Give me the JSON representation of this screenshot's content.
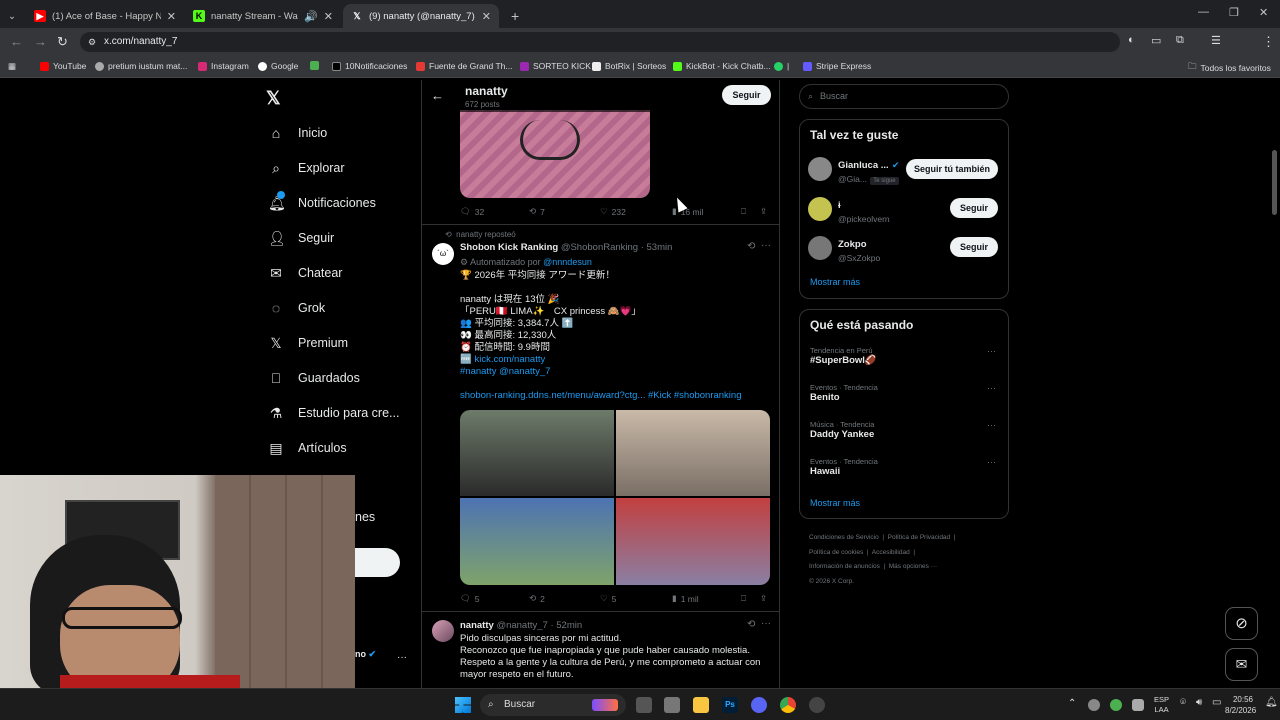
{
  "browser": {
    "tabs": [
      {
        "title": "(1) Ace of Base - Happy Nation",
        "color": "#ff0000"
      },
      {
        "title": "nanatty Stream - Watch Live",
        "color": "#53fc18"
      },
      {
        "title": "(9) nanatty (@nanatty_7) / X",
        "color": "#ffffff"
      }
    ],
    "new_tab": "+",
    "url": "x.com/nanatty_7",
    "bookmarks": [
      "YouTube",
      "pretium iustum mat...",
      "Instagram",
      "Google",
      "10Notificaciones",
      "Fuente de Grand Th...",
      "SORTEO KICK",
      "BotRix | Sorteos",
      "KickBot - Kick Chatb...",
      "Stripe Express"
    ],
    "bookmarks_all": "Todos los favoritos"
  },
  "nav": {
    "items": [
      "Inicio",
      "Explorar",
      "Notificaciones",
      "Seguir",
      "Chatear",
      "Grok",
      "Premium",
      "Guardados",
      "Estudio para cre...",
      "Artículos"
    ],
    "partial_item": "nes",
    "account_partial": "no"
  },
  "profile_header": {
    "name": "nanatty",
    "posts": "672 posts",
    "follow": "Seguir"
  },
  "post0": {
    "replies": "32",
    "reposts": "7",
    "likes": "232",
    "views": "16 mil"
  },
  "post1": {
    "reposted_by": "nanatty reposteó",
    "author": "Shobon Kick Ranking",
    "handle": "@ShobonRanking · 53min",
    "automated": "Automatizado por",
    "automated_by": "@nnndesun",
    "lines": [
      "🏆 2026年 平均同接 アワード更新！",
      "",
      "nanatty は現在 13位 🎉",
      "「PERU🇵🇪 LIMA✨　CX princess 🙈💗」",
      "👥 平均同接: 3,384.7人 ⬆️",
      "👀 最高同接: 12,330人",
      "⏰ 配信時間: 9.9時間"
    ],
    "kick_link": "kick.com/nanatty",
    "tags": "#nanatty @nanatty_7",
    "url_line": "shobon-ranking.ddns.net/menu/award?ctg... #Kick #shobonranking",
    "replies": "5",
    "reposts": "2",
    "likes": "5",
    "views": "1 mil"
  },
  "post2": {
    "author": "nanatty",
    "handle": "@nanatty_7 · 52min",
    "lines": [
      "Pido disculpas sinceras por mi actitud.",
      "Reconozco que fue inapropiada y que pude haber causado molestia.",
      "Respeto a la gente y la cultura de Perú, y me comprometo a actuar con",
      "mayor respeto en el futuro."
    ]
  },
  "right": {
    "search_placeholder": "Buscar",
    "suggest_title": "Tal vez te guste",
    "suggestions": [
      {
        "name": "Gianluca ...",
        "handle": "@Gia...",
        "badge": "Te sigue",
        "button": "Seguir tú también"
      },
      {
        "name": "ɨ",
        "handle": "@pickeolvern",
        "button": "Seguir"
      },
      {
        "name": "Zokpo",
        "handle": "@SxZokpo",
        "button": "Seguir"
      }
    ],
    "show_more": "Mostrar más",
    "trends_title": "Qué está pasando",
    "trends": [
      {
        "category": "Tendencia en Perú",
        "name": "#SuperBowl🏈"
      },
      {
        "category": "Eventos · Tendencia",
        "name": "Benito"
      },
      {
        "category": "Música · Tendencia",
        "name": "Daddy Yankee"
      },
      {
        "category": "Eventos · Tendencia",
        "name": "Hawaii"
      }
    ],
    "trends_more": "Mostrar más",
    "footer": [
      "Condiciones de Servicio",
      "Política de Privacidad",
      "Política de cookies",
      "Accesibilidad",
      "Información de anuncios",
      "Más opciones ···",
      "© 2026 X Corp."
    ]
  },
  "taskbar": {
    "search": "Buscar",
    "lang1": "ESP",
    "lang2": "LAA",
    "time": "20:56",
    "date": "8/2/2026"
  }
}
